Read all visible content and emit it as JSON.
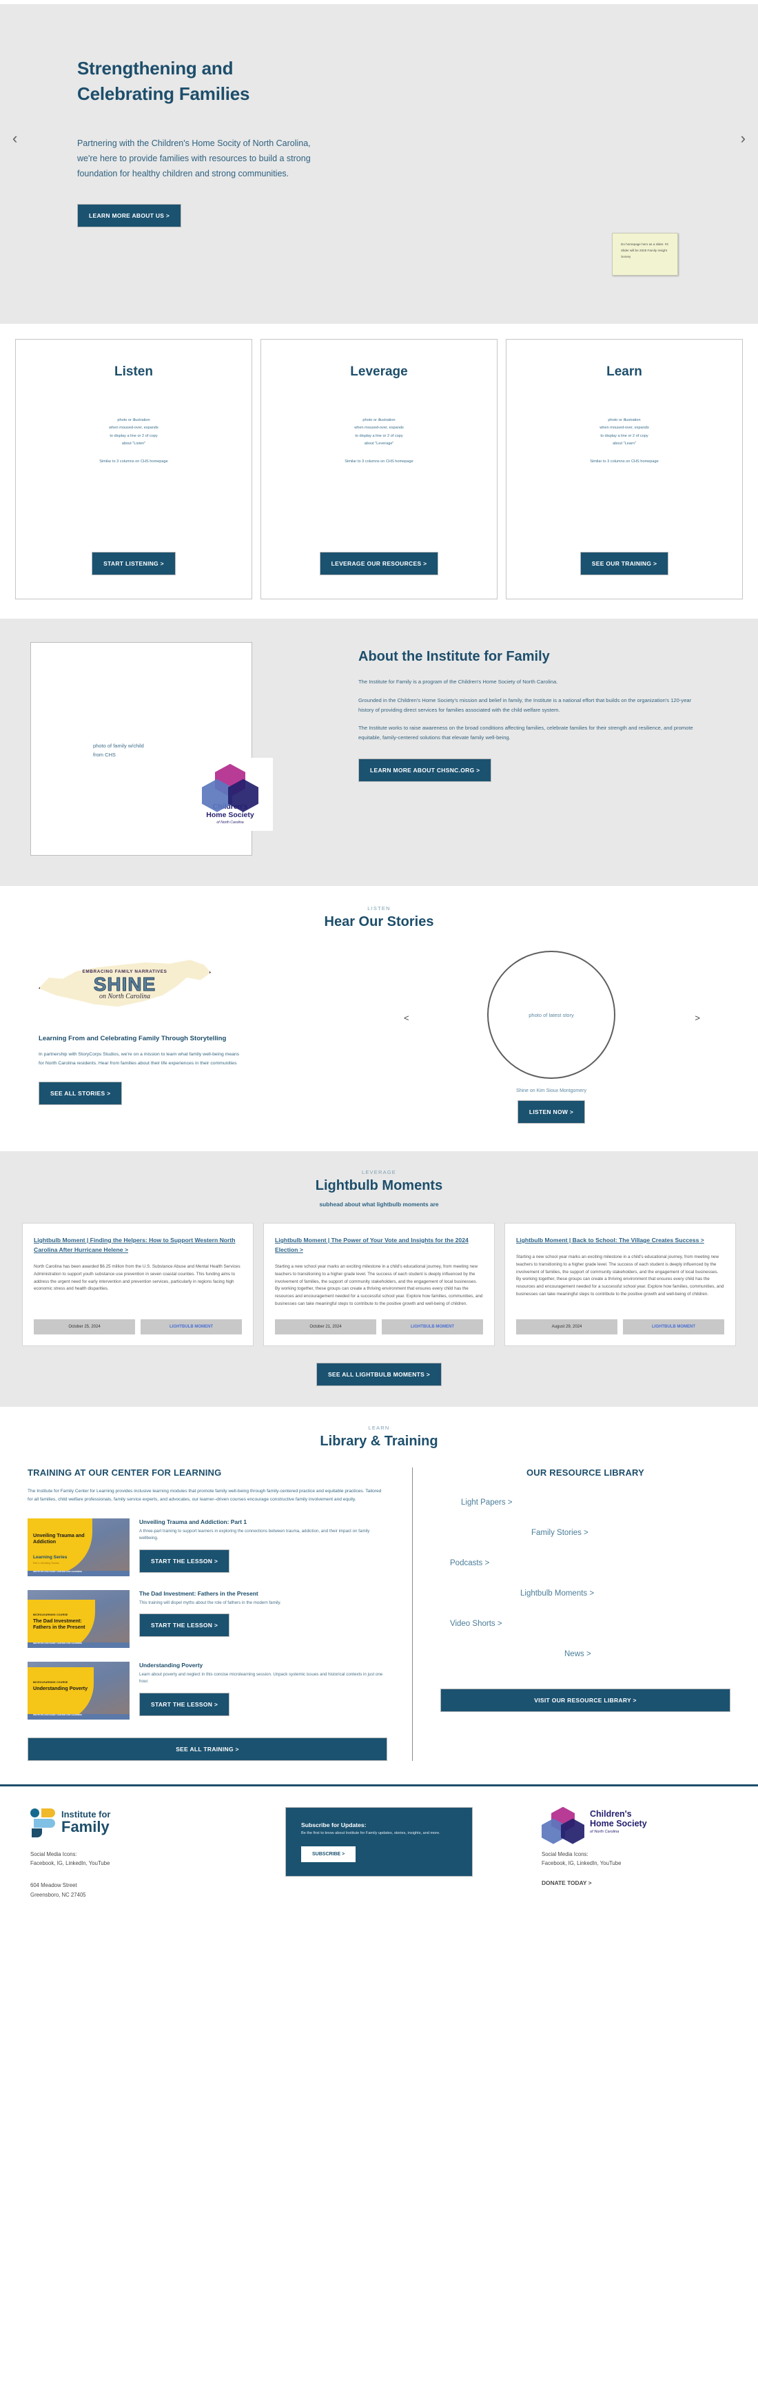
{
  "hero": {
    "title_line1": "Strengthening and",
    "title_line2": "Celebrating Families",
    "subtitle": "Partnering with the Children's Home Socity of North Carolina, we're here to provide families with resources to build a strong foundation for healthy children and strong communities.",
    "cta": "LEARN MORE ABOUT US >",
    "prev_arrow": "‹",
    "next_arrow": "›",
    "sticky_note": "Do homepage hero as a slider. #2 Slider will be 2025 Family Insight Survey"
  },
  "columns": [
    {
      "title": "Listen",
      "note": "photo or illustration\nwhen moused-over, expands\nto display a line or 2 of copy\nabout \"Listen\"",
      "note2": "Similar to 3 columns on CHS homepage",
      "cta": "START LISTENING >"
    },
    {
      "title": "Leverage",
      "note": "photo or illustration\nwhen moused-over, expands\nto display a line or 2 of copy\nabout \"Leverage\"",
      "note2": "Similar to 3 columns on CHS homepage",
      "cta": "LEVERAGE OUR RESOURCES >"
    },
    {
      "title": "Learn",
      "note": "photo or illustration\nwhen moused-over, expands\nto display a line or 2 of copy\nabout \"Learn\"",
      "note2": "Similar to 3 columns on CHS homepage",
      "cta": "SEE OUR TRAINING >"
    }
  ],
  "about": {
    "photo_placeholder": "photo of family w/child\nfrom CHS",
    "logo_name_line1": "Children's",
    "logo_name_line2": "Home Society",
    "logo_sub": "of North Carolina",
    "heading": "About the Institute for Family",
    "p1": "The Institute for Family is a program of the Children's Home Society of North Carolina.",
    "p2": "Grounded in the Children's Home Society's mission and belief in family, the Institute is a national effort that builds on the organization's 120-year history of providing direct services for families associated with the child welfare system.",
    "p3": "The Institute works to raise awareness on the broad conditions affecting families, celebrate families for their strength and resilience, and promote equitable, family-centered solutions that elevate family well-being.",
    "cta": "LEARN MORE ABOUT CHSNC.ORG  >"
  },
  "stories": {
    "eyebrow": "LISTEN",
    "title": "Hear Our Stories",
    "shine_kicker": "EMBRACING FAMILY NARRATIVES",
    "shine_word": "SHINE",
    "shine_state": "on North Carolina",
    "heading": "Learning From and Celebrating Family Through Storytelling",
    "paragraph": "In partnership with StoryCorps Studios, we're on a mission to learn what family well-being means for North Carolina residents. Hear from families about their life experiences in their communities",
    "cta": "SEE ALL STORIES >",
    "circle_placeholder": "photo of latest story",
    "circle_caption": "Shine on Kim Sioux Montgomery",
    "circle_cta": "LISTEN NOW >",
    "prev_arrow": "<",
    "next_arrow": ">"
  },
  "lightbulb": {
    "eyebrow": "LEVERAGE",
    "title": "Lightbulb Moments",
    "subhead": "subhead about what lightbulb moments are",
    "cards": [
      {
        "title": "Lightbulb Moment | Finding the Helpers: How to Support Western North Carolina After Hurricane Helene >",
        "body": "North Carolina has been awarded $6.25 million from the U.S. Substance Abuse and Mental Health Services Administration to support youth substance use prevention in seven coastal counties. This funding aims to address the urgent need for early intervention and prevention services, particularly in regions facing high economic stress and health disparities.",
        "date": "October 25, 2024",
        "tag": "LIGHTBULB MOMENT"
      },
      {
        "title": "Lightbulb Moment | The Power of Your Vote and Insights for the 2024 Election >",
        "body": "Starting a new school year marks an exciting milestone in a child's educational journey, from meeting new teachers to transitioning to a higher grade level. The success of each student is deeply influenced by the involvement of families, the support of community stakeholders, and the engagement of local businesses. By working together, these groups can create a thriving environment that ensures every child has the resources and encouragement needed for a successful school year. Explore how families, communities, and businesses can take meaningful steps to contribute to the positive growth and well-being of children.",
        "date": "October 21, 2024",
        "tag": "LIGHTBULB MOMENT"
      },
      {
        "title": "Lightbulb Moment | Back to School: The Village Creates Success >",
        "body": "Starting a new school year marks an exciting milestone in a child's educational journey, from meeting new teachers to transitioning to a higher grade level. The success of each student is deeply influenced by the involvement of families, the support of community stakeholders, and the engagement of local businesses. By working together, these groups can create a thriving environment that ensures every child has the resources and encouragement needed for a successful school year. Explore how families, communities, and businesses can take meaningful steps to contribute to the positive growth and well-being of children.",
        "date": "August 29, 2024",
        "tag": "LIGHTBULB MOMENT"
      }
    ],
    "cta": "SEE ALL LIGHTBULB MOMENTS >"
  },
  "library": {
    "eyebrow": "LEARN",
    "title": "Library & Training",
    "training_heading": "TRAINING AT OUR CENTER FOR LEARNING",
    "training_paragraph": "The Institute for Family Center for Learning provides inclusive learning modules that promote family well-being through family-centered practice and equitable practices. Tailored for all families, child welfare professionals, family service experts, and advocates, our learner–driven courses encourage constructive family involvement and equity.",
    "courses": [
      {
        "thumb_kicker": "",
        "thumb_title": "Unveiling Trauma and Addiction",
        "thumb_series": "Learning Series",
        "thumb_sub": "Part 1: Unveiling Trauma",
        "thumb_logo": "INSTITUTE FOR FAMILY CENTER FOR LEARNING",
        "title": "Unveiling Trauma and Addiction: Part 1",
        "desc": "A three-part training to support learners in exploring the connections between trauma, addiction, and their impact on family wellbeing.",
        "cta": "START THE LESSON >"
      },
      {
        "thumb_kicker": "MICROLEARNING COURSE",
        "thumb_title": "The Dad Investment: Fathers in the Present",
        "thumb_series": "",
        "thumb_sub": "",
        "thumb_logo": "INSTITUTE FOR FAMILY CENTER FOR LEARNING",
        "title": "The Dad Investment: Fathers in the Present",
        "desc": "This training will dispel myths about the role of fathers in the modern family.",
        "cta": "START THE LESSON >"
      },
      {
        "thumb_kicker": "MICROLEARNING COURSE",
        "thumb_title": "Understanding Poverty",
        "thumb_series": "",
        "thumb_sub": "",
        "thumb_logo": "INSTITUTE FOR FAMILY CENTER FOR LEARNING",
        "title": "Understanding Poverty",
        "desc": "Learn about poverty and neglect in this concise microlearning session. Unpack systemic issues and historical contexts in just one hour.",
        "cta": "START THE LESSON >"
      }
    ],
    "training_cta": "SEE ALL TRAINING >",
    "resource_heading": "OUR RESOURCE LIBRARY",
    "resource_links": [
      "Light Papers >",
      "Family Stories >",
      "Podcasts >",
      "Lightbulb Moments >",
      "Video Shorts >",
      "News >"
    ],
    "resource_cta": "VISIT OUR RESOURCE LIBRARY >"
  },
  "footer": {
    "iff_logo_line1": "Institute for",
    "iff_logo_line2": "Family",
    "social_label": "Social Media Icons:",
    "social_list": "Facebook, IG, LinkedIn, YouTube",
    "address_line1": "604 Meadow Street",
    "address_line2": "Greensboro, NC 27405",
    "subscribe_heading": "Subscribe for Updates:",
    "subscribe_text": "Be the first to know about Institute for Family updates, stories, insights, and more.",
    "subscribe_cta": "SUBSCRIBE >",
    "chs_name_line1": "Children's",
    "chs_name_line2": "Home Society",
    "chs_sub": "of North Carolina",
    "chs_social_label": "Social Media Icons:",
    "chs_social_list": "Facebook, IG, LinkedIn, YouTube",
    "donate_cta": "DONATE TODAY >"
  }
}
